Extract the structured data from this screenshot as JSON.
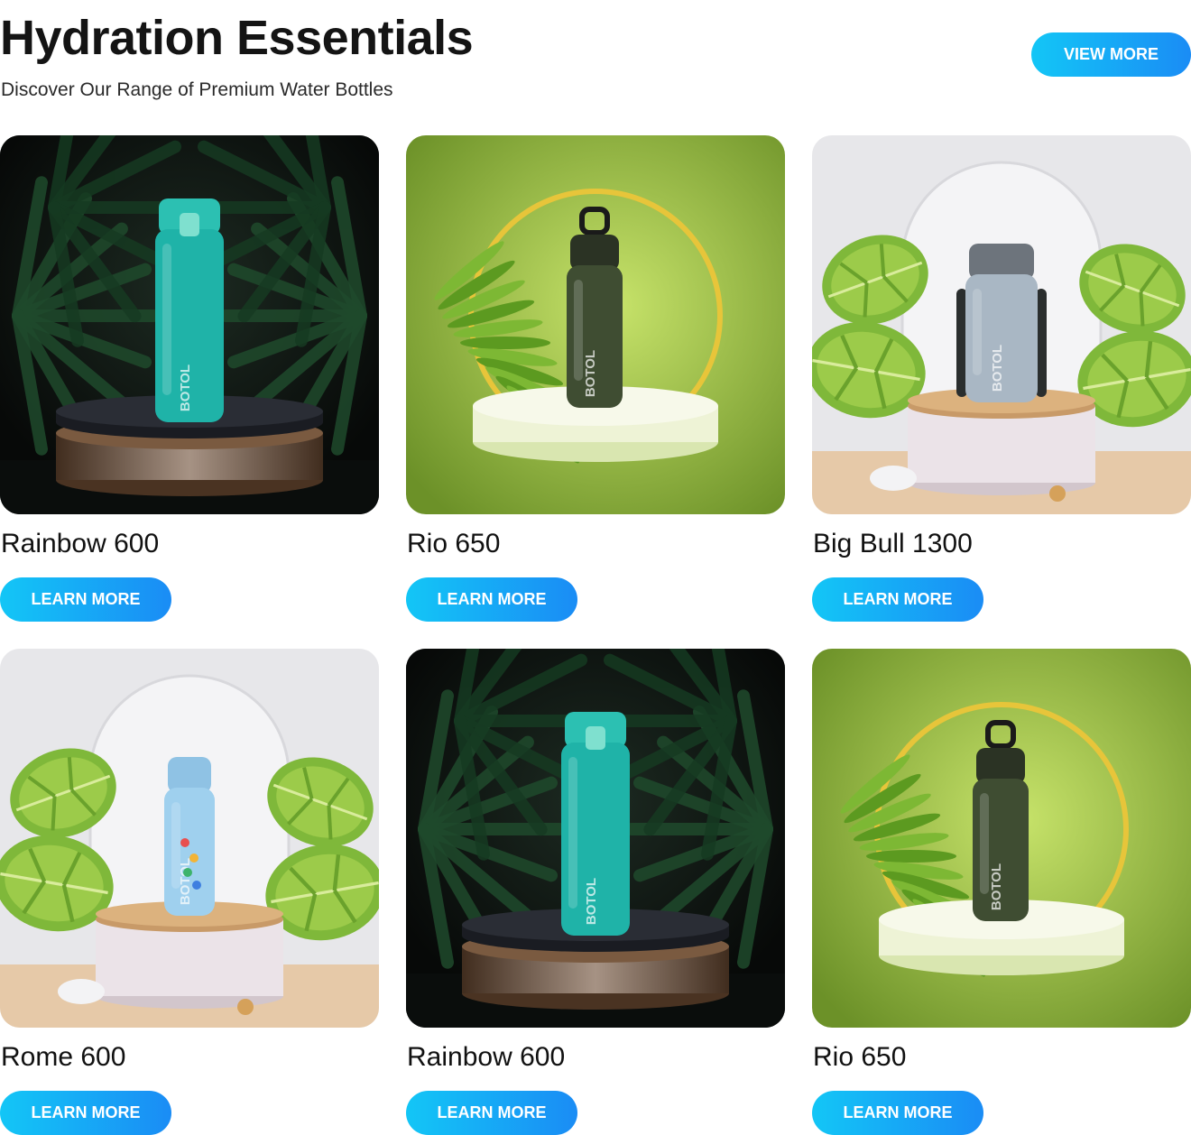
{
  "header": {
    "title": "Hydration Essentials",
    "subtitle": "Discover Our Range of Premium Water Bottles",
    "view_more_label": "VIEW MORE"
  },
  "products": [
    {
      "name": "Rainbow 600",
      "button": "LEARN MORE",
      "scene": "dark",
      "bottle_color": "#1fb3a8",
      "bottle_brand": "BOTOL"
    },
    {
      "name": "Rio 650",
      "button": "LEARN MORE",
      "scene": "green",
      "bottle_color": "#3f4d32",
      "bottle_brand": "BOTOL"
    },
    {
      "name": "Big Bull 1300",
      "button": "LEARN MORE",
      "scene": "light",
      "bottle_color": "#a9b7c4",
      "bottle_brand": "BOTOL"
    },
    {
      "name": "Rome 600",
      "button": "LEARN MORE",
      "scene": "light",
      "bottle_color": "#9fd0ee",
      "bottle_brand": "BOTOL"
    },
    {
      "name": "Rainbow 600",
      "button": "LEARN MORE",
      "scene": "dark",
      "bottle_color": "#1fb3a8",
      "bottle_brand": "BOTOL"
    },
    {
      "name": "Rio 650",
      "button": "LEARN MORE",
      "scene": "green",
      "bottle_color": "#3f4d32",
      "bottle_brand": "BOTOL"
    }
  ],
  "colors": {
    "button_start": "#13c6f6",
    "button_end": "#1a8cf5"
  }
}
